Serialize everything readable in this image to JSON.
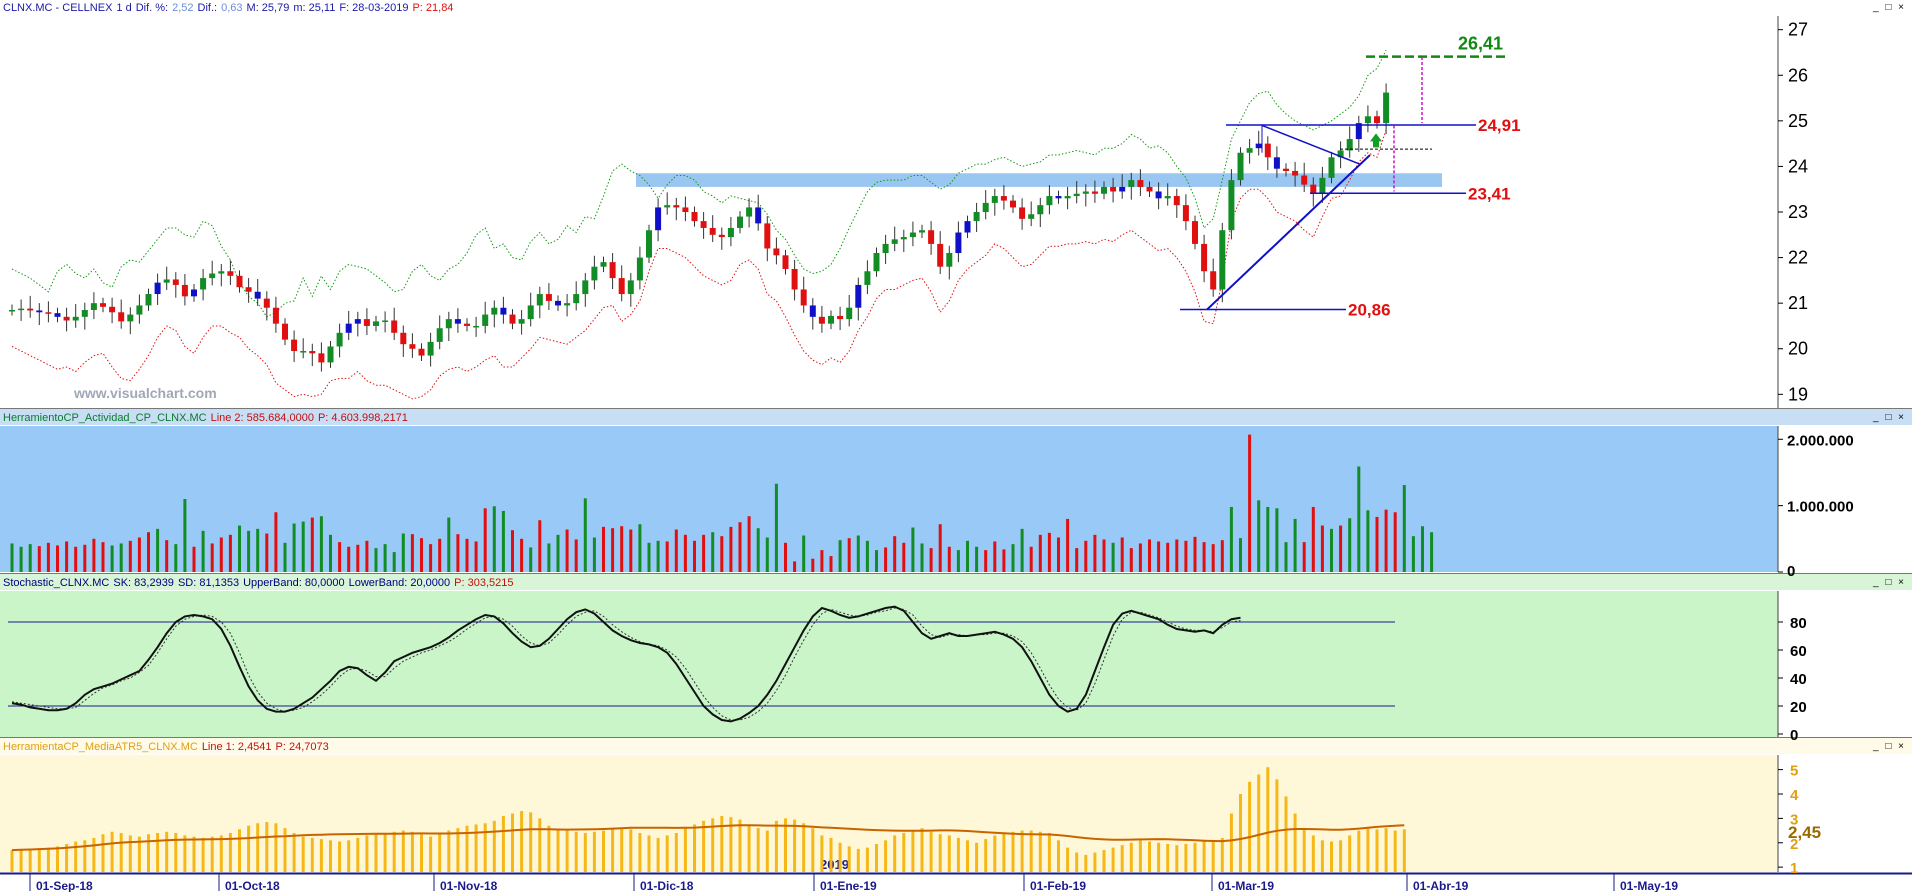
{
  "panels": {
    "price": {
      "title_parts": [
        {
          "text": "CLNX.MC - CELLNEX",
          "color": "#1a1aa6"
        },
        {
          "text": "1 d",
          "color": "#1a1aa6"
        },
        {
          "text": "Dif. %:",
          "color": "#1a1aa6"
        },
        {
          "text": "2,52",
          "color": "#6a8fd8"
        },
        {
          "text": "Dif.:",
          "color": "#1a1aa6"
        },
        {
          "text": "0,63",
          "color": "#6a8fd8"
        },
        {
          "text": "M: 25,79",
          "color": "#1a1aa6"
        },
        {
          "text": "m: 25,11",
          "color": "#1a1aa6"
        },
        {
          "text": "F: 28-03-2019",
          "color": "#1a1aa6"
        },
        {
          "text": "P: 21,84",
          "color": "#e01010"
        }
      ],
      "watermark": "www.visualchart.com"
    },
    "volume": {
      "title_parts": [
        {
          "text": "HerramientoCP_Actividad_CP_CLNX.MC",
          "color": "#0a7a2a"
        },
        {
          "text": "Line 2: 585.684,0000",
          "color": "#c01010"
        },
        {
          "text": "P: 4.603.998,2171",
          "color": "#c01010"
        }
      ]
    },
    "stochastic": {
      "title_parts": [
        {
          "text": "Stochastic_CLNX.MC",
          "color": "#000080"
        },
        {
          "text": "SK: 83,2939",
          "color": "#000080"
        },
        {
          "text": "SD: 81,1353",
          "color": "#000080"
        },
        {
          "text": "UpperBand: 80,0000",
          "color": "#000080"
        },
        {
          "text": "LowerBand: 20,0000",
          "color": "#000080"
        },
        {
          "text": "P: 303,5215",
          "color": "#c01010"
        }
      ]
    },
    "atr": {
      "title_parts": [
        {
          "text": "HerramientaCP_MediaATR5_CLNX.MC",
          "color": "#e0a010"
        },
        {
          "text": "Line 1: 2,4541",
          "color": "#c01010"
        },
        {
          "text": "P: 24,7073",
          "color": "#c01010"
        }
      ]
    }
  },
  "window_buttons": "_ □ ×",
  "chart_data": {
    "type": "candlestick",
    "instrument": "CLNX.MC - CELLNEX",
    "x_labels": [
      "01-Sep-18",
      "01-Oct-18",
      "01-Nov-18",
      "01-Dic-18",
      "01-Ene-19",
      "01-Feb-19",
      "01-Mar-19",
      "01-Abr-19",
      "01-May-19"
    ],
    "year_marker": "2019",
    "price_ylim": [
      18.7,
      27.3
    ],
    "price_ticks": [
      "27",
      "26",
      "25",
      "24",
      "23",
      "22",
      "21",
      "20",
      "19"
    ],
    "price_levels": [
      {
        "label": "26,41",
        "value": 26.41,
        "color": "#118811"
      },
      {
        "label": "24,91",
        "value": 24.91,
        "color": "#e01010"
      },
      {
        "label": "23,41",
        "value": 23.41,
        "color": "#e01010"
      },
      {
        "label": "20,86",
        "value": 20.86,
        "color": "#e01010"
      }
    ],
    "resistance_zone": [
      23.55,
      23.85
    ],
    "closes": [
      20.85,
      20.88,
      20.84,
      20.8,
      20.78,
      20.7,
      20.62,
      20.7,
      20.85,
      21.0,
      20.92,
      20.8,
      20.6,
      20.75,
      20.95,
      21.2,
      21.45,
      21.52,
      21.4,
      21.15,
      21.3,
      21.55,
      21.65,
      21.7,
      21.6,
      21.35,
      21.25,
      21.1,
      20.9,
      20.55,
      20.2,
      19.95,
      19.95,
      19.9,
      19.7,
      20.05,
      20.35,
      20.55,
      20.65,
      20.5,
      20.6,
      20.62,
      20.35,
      20.1,
      20.0,
      19.85,
      20.15,
      20.45,
      20.65,
      20.55,
      20.5,
      20.5,
      20.75,
      20.9,
      20.75,
      20.55,
      20.65,
      20.95,
      21.2,
      21.05,
      20.95,
      21.0,
      21.2,
      21.5,
      21.8,
      21.9,
      21.55,
      21.2,
      21.5,
      22.0,
      22.6,
      23.1,
      23.15,
      23.1,
      23.0,
      22.8,
      22.65,
      22.5,
      22.45,
      22.65,
      22.9,
      23.1,
      22.75,
      22.2,
      22.05,
      21.75,
      21.3,
      20.95,
      20.7,
      20.55,
      20.72,
      20.65,
      20.9,
      21.4,
      21.7,
      22.1,
      22.3,
      22.4,
      22.45,
      22.55,
      22.6,
      22.3,
      21.8,
      22.1,
      22.55,
      22.8,
      23.0,
      23.2,
      23.35,
      23.25,
      23.1,
      22.85,
      22.95,
      23.15,
      23.35,
      23.3,
      23.35,
      23.4,
      23.45,
      23.4,
      23.55,
      23.45,
      23.55,
      23.7,
      23.55,
      23.45,
      23.3,
      23.35,
      23.15,
      22.8,
      22.3,
      21.7,
      21.3,
      22.6,
      23.7,
      24.3,
      24.4,
      24.5,
      24.2,
      23.95,
      23.9,
      23.8,
      23.6,
      23.4,
      23.75,
      24.2,
      24.35,
      24.6,
      24.95,
      25.1,
      24.95,
      25.62
    ],
    "upper_band": [
      21.75,
      21.65,
      21.55,
      21.4,
      21.25,
      21.7,
      21.85,
      21.65,
      21.55,
      21.75,
      21.45,
      21.35,
      21.8,
      21.95,
      21.9,
      22.15,
      22.4,
      22.65,
      22.65,
      22.5,
      22.45,
      22.8,
      22.7,
      22.25,
      21.95,
      21.45,
      21.15,
      21.0,
      20.7,
      20.8,
      21.0,
      21.05,
      21.55,
      21.15,
      21.6,
      21.3,
      21.7,
      21.85,
      21.8,
      21.75,
      21.6,
      21.45,
      21.25,
      21.3,
      21.7,
      21.85,
      21.6,
      21.5,
      21.75,
      21.85,
      22.1,
      22.5,
      22.65,
      22.2,
      22.3,
      22.0,
      21.95,
      22.35,
      22.55,
      22.3,
      22.4,
      22.7,
      22.55,
      22.9,
      22.85,
      23.35,
      23.9,
      24.05,
      23.9,
      23.8,
      23.6,
      23.3,
      23.6,
      23.8,
      23.8,
      23.7,
      23.45,
      23.35,
      23.2,
      23.35,
      23.3,
      23.25,
      23.2,
      22.95,
      22.6,
      22.4,
      22.05,
      21.75,
      21.65,
      21.7,
      21.85,
      22.2,
      22.65,
      23.05,
      23.45,
      23.65,
      23.7,
      23.7,
      23.7,
      23.8,
      23.8,
      23.65,
      23.5,
      23.6,
      23.85,
      23.95,
      24.05,
      24.05,
      24.15,
      24.2,
      24.1,
      24.0,
      24.05,
      24.1,
      24.25,
      24.25,
      24.3,
      24.35,
      24.3,
      24.25,
      24.4,
      24.4,
      24.5,
      24.7,
      24.6,
      24.4,
      24.45,
      24.3,
      24.0,
      23.75,
      23.3,
      22.65,
      22.85,
      23.7,
      24.6,
      25.0,
      25.4,
      25.6,
      25.65,
      25.35,
      25.15,
      25.0,
      24.9,
      24.8,
      24.9,
      25.0,
      25.15,
      25.3,
      25.55,
      26.0,
      26.15,
      26.55
    ],
    "lower_band": [
      20.05,
      19.95,
      19.85,
      19.75,
      19.65,
      19.55,
      19.6,
      19.5,
      19.7,
      19.85,
      19.9,
      19.6,
      19.35,
      19.3,
      19.55,
      19.85,
      20.25,
      20.5,
      20.4,
      20.05,
      19.9,
      20.25,
      20.5,
      20.5,
      20.35,
      20.25,
      20.0,
      19.85,
      19.65,
      19.25,
      19.1,
      18.95,
      19.0,
      18.95,
      19.0,
      19.3,
      19.35,
      19.35,
      19.5,
      19.3,
      19.2,
      19.2,
      19.1,
      19.0,
      18.9,
      18.95,
      19.1,
      19.4,
      19.55,
      19.6,
      19.5,
      19.6,
      19.75,
      19.85,
      19.6,
      19.6,
      19.8,
      20.0,
      20.25,
      20.2,
      20.15,
      20.1,
      20.25,
      20.4,
      20.65,
      20.9,
      20.95,
      20.6,
      20.75,
      21.05,
      21.7,
      22.2,
      22.2,
      22.1,
      22.0,
      21.8,
      21.6,
      21.5,
      21.4,
      21.5,
      21.85,
      21.95,
      21.75,
      21.2,
      21.05,
      20.7,
      20.3,
      19.95,
      19.75,
      19.65,
      19.8,
      19.7,
      19.95,
      20.4,
      20.7,
      21.1,
      21.3,
      21.3,
      21.4,
      21.5,
      21.55,
      21.25,
      20.8,
      21.05,
      21.5,
      21.75,
      21.9,
      22.05,
      22.3,
      22.2,
      22.0,
      21.8,
      21.85,
      22.05,
      22.25,
      22.25,
      22.3,
      22.3,
      22.35,
      22.3,
      22.4,
      22.35,
      22.5,
      22.6,
      22.45,
      22.3,
      22.15,
      22.2,
      22.0,
      21.7,
      21.25,
      20.6,
      20.55,
      21.5,
      22.8,
      23.3,
      23.5,
      23.5,
      23.3,
      23.0,
      22.9,
      22.8,
      22.6,
      22.45,
      22.9,
      23.3,
      23.35,
      23.7,
      24.1,
      24.3,
      24.2,
      24.8
    ],
    "volume_ticks": [
      "2.000.000",
      "1.000.000",
      "0"
    ],
    "volume_ylim": [
      0,
      2200000
    ],
    "volumes": [
      430000,
      380000,
      420000,
      390000,
      440000,
      400000,
      460000,
      380000,
      410000,
      500000,
      450000,
      400000,
      430000,
      470000,
      520000,
      600000,
      650000,
      480000,
      420000,
      1100000,
      380000,
      620000,
      430000,
      520000,
      560000,
      700000,
      620000,
      650000,
      580000,
      900000,
      440000,
      730000,
      760000,
      820000,
      840000,
      560000,
      450000,
      380000,
      410000,
      470000,
      360000,
      420000,
      300000,
      580000,
      570000,
      510000,
      420000,
      500000,
      820000,
      570000,
      500000,
      460000,
      960000,
      990000,
      920000,
      630000,
      500000,
      370000,
      780000,
      430000,
      560000,
      640000,
      490000,
      1110000,
      520000,
      680000,
      660000,
      690000,
      640000,
      720000,
      440000,
      470000,
      460000,
      640000,
      560000,
      470000,
      560000,
      600000,
      540000,
      680000,
      750000,
      840000,
      660000,
      520000,
      1330000,
      440000,
      160000,
      550000,
      200000,
      330000,
      240000,
      480000,
      510000,
      550000,
      470000,
      330000,
      370000,
      540000,
      440000,
      670000,
      430000,
      360000,
      720000,
      380000,
      330000,
      470000,
      380000,
      330000,
      460000,
      340000,
      420000,
      650000,
      380000,
      560000,
      590000,
      520000,
      800000,
      360000,
      470000,
      560000,
      490000,
      440000,
      520000,
      360000,
      430000,
      490000,
      460000,
      440000,
      490000,
      470000,
      530000,
      450000,
      420000,
      480000,
      980000,
      510000,
      2070000,
      1080000,
      980000,
      960000,
      450000,
      800000,
      450000,
      980000,
      700000,
      650000,
      700000,
      810000,
      1590000,
      930000,
      830000,
      940000,
      900000,
      1310000,
      540000,
      690000,
      600000
    ],
    "volume_colors": "gggrrrrrrrrggrrrgrggrgrrrgggrrgggrggrrrrggggrrrrgrrrrggrrgrggrrggrrrrgggrrrrrgrrrrgggrrgrrrgrgggrrrggrrrgggrrrggrrrrrrrrrgrrrrrrrrrrrrggrgggggrrrgrgggrrrgggggrgrrgrgrggrgrg",
    "stoch_ticks": [
      "80",
      "60",
      "40",
      "20",
      "0"
    ],
    "stoch_bands": [
      80,
      20
    ],
    "stoch_k": [
      22,
      21,
      19,
      18,
      17,
      17,
      18,
      22,
      28,
      32,
      34,
      36,
      39,
      42,
      45,
      53,
      62,
      72,
      80,
      84,
      85,
      84,
      82,
      75,
      63,
      48,
      34,
      24,
      18,
      16,
      16,
      18,
      22,
      26,
      32,
      38,
      45,
      48,
      47,
      42,
      38,
      44,
      52,
      55,
      58,
      60,
      62,
      65,
      69,
      74,
      78,
      82,
      85,
      84,
      79,
      72,
      66,
      62,
      63,
      68,
      75,
      82,
      87,
      89,
      86,
      80,
      74,
      70,
      67,
      65,
      64,
      62,
      58,
      50,
      40,
      30,
      20,
      14,
      10,
      9,
      11,
      15,
      20,
      28,
      38,
      50,
      62,
      74,
      84,
      90,
      88,
      85,
      83,
      84,
      86,
      88,
      90,
      91,
      88,
      80,
      72,
      68,
      70,
      72,
      70,
      70,
      71,
      72,
      73,
      71,
      68,
      62,
      52,
      40,
      28,
      20,
      16,
      18,
      28,
      45,
      62,
      78,
      86,
      88,
      86,
      84,
      82,
      78,
      75,
      74,
      73,
      74,
      72,
      78,
      82,
      83
    ],
    "stoch_d": [
      23,
      22,
      21,
      20,
      19,
      18,
      18,
      19,
      24,
      29,
      33,
      35,
      38,
      40,
      44,
      49,
      58,
      68,
      77,
      82,
      84,
      85,
      84,
      80,
      72,
      58,
      42,
      30,
      22,
      18,
      16,
      17,
      19,
      23,
      28,
      34,
      41,
      46,
      47,
      45,
      41,
      41,
      47,
      52,
      55,
      58,
      60,
      63,
      66,
      70,
      75,
      79,
      83,
      84,
      82,
      77,
      70,
      65,
      63,
      65,
      71,
      78,
      84,
      87,
      88,
      84,
      78,
      73,
      69,
      66,
      64,
      63,
      60,
      55,
      47,
      37,
      27,
      19,
      13,
      10,
      10,
      12,
      16,
      22,
      31,
      42,
      55,
      67,
      78,
      86,
      89,
      87,
      85,
      84,
      85,
      87,
      88,
      90,
      89,
      85,
      77,
      71,
      69,
      71,
      71,
      70,
      71,
      71,
      72,
      72,
      70,
      66,
      58,
      47,
      35,
      25,
      19,
      17,
      22,
      36,
      53,
      70,
      82,
      87,
      87,
      85,
      83,
      80,
      77,
      75,
      74,
      74,
      73,
      76,
      80,
      81
    ],
    "atr_ticks": [
      "5",
      "4",
      "3",
      "2",
      "1"
    ],
    "atr_ylim": [
      0.8,
      5.6
    ],
    "atr_value_label": "2,45",
    "atr": [
      1.7,
      1.72,
      1.75,
      1.78,
      1.8,
      1.85,
      1.95,
      2.05,
      2.1,
      2.2,
      2.35,
      2.45,
      2.4,
      2.3,
      2.25,
      2.35,
      2.4,
      2.45,
      2.4,
      2.3,
      2.25,
      2.2,
      2.25,
      2.3,
      2.4,
      2.55,
      2.7,
      2.8,
      2.85,
      2.8,
      2.6,
      2.4,
      2.25,
      2.2,
      2.15,
      2.1,
      2.05,
      2.1,
      2.2,
      2.3,
      2.4,
      2.35,
      2.45,
      2.5,
      2.45,
      2.35,
      2.25,
      2.4,
      2.5,
      2.6,
      2.7,
      2.75,
      2.8,
      2.9,
      3.1,
      3.2,
      3.3,
      3.25,
      3.0,
      2.7,
      2.55,
      2.5,
      2.45,
      2.4,
      2.45,
      2.5,
      2.55,
      2.6,
      2.55,
      2.4,
      2.3,
      2.2,
      2.3,
      2.4,
      2.6,
      2.75,
      2.9,
      3.0,
      3.1,
      3.05,
      2.95,
      2.7,
      2.6,
      2.5,
      2.9,
      3.0,
      2.95,
      2.8,
      2.6,
      2.3,
      2.2,
      2.0,
      1.85,
      1.75,
      1.8,
      1.95,
      2.1,
      2.3,
      2.4,
      2.5,
      2.6,
      2.45,
      2.35,
      2.3,
      2.2,
      2.1,
      2.0,
      2.15,
      2.3,
      2.4,
      2.45,
      2.5,
      2.5,
      2.45,
      2.4,
      2.1,
      1.8,
      1.6,
      1.5,
      1.6,
      1.7,
      1.8,
      1.9,
      2.0,
      2.1,
      2.05,
      2.0,
      1.95,
      1.9,
      1.95,
      2.0,
      2.05,
      2.1,
      2.2,
      3.2,
      4.0,
      4.5,
      4.8,
      5.1,
      4.6,
      3.9,
      3.2,
      2.6,
      2.3,
      2.1,
      2.05,
      2.1,
      2.3,
      2.5,
      2.6,
      2.55,
      2.6,
      2.5,
      2.55
    ]
  }
}
